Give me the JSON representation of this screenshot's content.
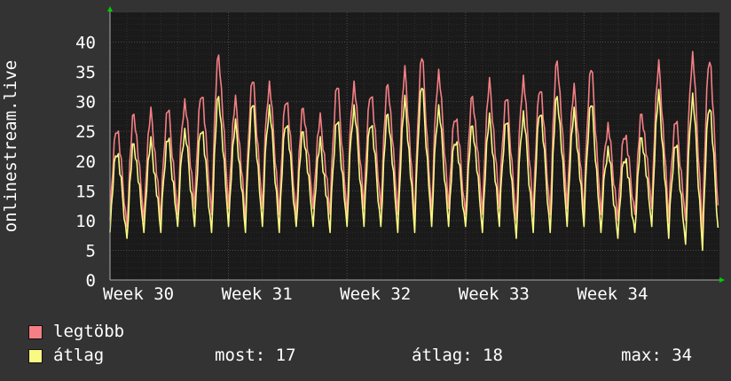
{
  "chart_data": {
    "type": "line",
    "ylabel": "onlinestream.live",
    "ylim": [
      0,
      45
    ],
    "yticks": [
      0,
      5,
      10,
      15,
      20,
      25,
      30,
      35,
      40
    ],
    "xticks": [
      "Week 30",
      "Week 31",
      "Week 32",
      "Week 33",
      "Week 34"
    ],
    "grid": true,
    "colors": {
      "background": "#333333",
      "plot": "#1a1a1a",
      "grid": "#3f3f3f",
      "axis_arrow": "#00cc00"
    },
    "daily_peaks": {
      "legtobb": [
        26,
        28,
        28,
        29,
        30,
        32,
        38,
        30,
        34,
        33,
        31,
        29,
        27,
        33,
        33,
        32,
        33,
        35,
        38,
        35,
        28,
        31,
        33,
        31,
        34,
        33,
        37,
        32,
        36,
        26,
        25,
        28,
        36,
        27,
        38,
        38
      ],
      "atlag": [
        22,
        23,
        23,
        24,
        25,
        26,
        31,
        26,
        30,
        29,
        27,
        25,
        23,
        27,
        29,
        27,
        28,
        30,
        33,
        29,
        24,
        26,
        27,
        27,
        28,
        29,
        31,
        28,
        30,
        22,
        21,
        24,
        31,
        23,
        31,
        30
      ]
    },
    "daily_troughs": {
      "legtobb": [
        10,
        9,
        10,
        10,
        11,
        12,
        11,
        12,
        10,
        12,
        11,
        11,
        12,
        11,
        11,
        12,
        12,
        11,
        10,
        11,
        12,
        11,
        11,
        12,
        10,
        11,
        11,
        12,
        11,
        11,
        10,
        11,
        12,
        10,
        10,
        8
      ],
      "atlag": [
        8,
        7,
        8,
        8,
        9,
        9,
        8,
        9,
        8,
        9,
        8,
        9,
        9,
        8,
        9,
        9,
        9,
        8,
        8,
        9,
        9,
        9,
        8,
        9,
        7,
        8,
        8,
        9,
        9,
        8,
        7,
        8,
        9,
        7,
        6,
        5
      ]
    },
    "series": [
      {
        "name": "legtöbb",
        "color": "#f47f84"
      },
      {
        "name": "átlag",
        "color": "#f9fa82"
      }
    ]
  },
  "legend": {
    "items": [
      {
        "label": "legtöbb",
        "color": "#f47f84"
      },
      {
        "label": "átlag",
        "color": "#f9fa82"
      }
    ]
  },
  "stats": {
    "most": "most: 17",
    "atlag": "átlag: 18",
    "max": "max: 34"
  }
}
